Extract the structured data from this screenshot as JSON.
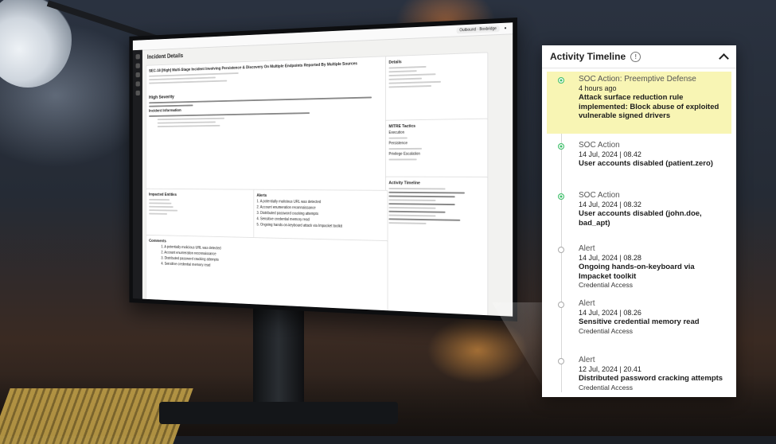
{
  "monitor": {
    "page_title": "Incident Details",
    "incident_title": "SEC-18 [High] Multi-Stage Incident Involving Persistence & Discovery On Multiple Endpoints Reported By Multiple Sources",
    "severity": "High Severity",
    "user": "Outbound · Boxbridge",
    "sections": {
      "details": "Details",
      "mitre": "MITRE Tactics",
      "execution": "Execution",
      "persistence": "Persistence",
      "privesc": "Privilege Escalation",
      "impacted": "Impacted Entities",
      "alerts": "Alerts",
      "comments": "Comments",
      "timeline": "Activity Timeline",
      "info": "Incident Information"
    },
    "alerts_list": [
      "1. A potentially malicious URL was detected",
      "2. Account enumeration reconnaissance",
      "3. Distributed password cracking attempts",
      "4. Sensitive credential memory read",
      "5. Ongoing hands-on-keyboard attack via Impacket toolkit"
    ],
    "comments_list": [
      "1. A potentially malicious URL was detected",
      "2. Account enumeration reconnaissance",
      "3. Distributed password cracking attempts",
      "4. Sensitive credential memory read"
    ]
  },
  "timeline": {
    "title": "Activity Timeline",
    "entries": [
      {
        "type": "SOC Action: Preemptive Defense",
        "time": "4 hours ago",
        "desc": "Attack surface reduction rule implemented: Block abuse of exploited vulnerable signed drivers",
        "tactic": "",
        "marker": "green",
        "highlight": true
      },
      {
        "type": "SOC Action",
        "time": "14 Jul, 2024 | 08.42",
        "desc": "User accounts disabled (patient.zero)",
        "tactic": "",
        "marker": "green",
        "highlight": false
      },
      {
        "type": "SOC Action",
        "time": "14 Jul, 2024 | 08.32",
        "desc": "User accounts disabled (john.doe, bad_apt)",
        "tactic": "",
        "marker": "green",
        "highlight": false
      },
      {
        "type": "Alert",
        "time": "14 Jul, 2024 | 08.28",
        "desc": "Ongoing hands-on-keyboard via Impacket toolkit",
        "tactic": "Credential Access",
        "marker": "grey",
        "highlight": false
      },
      {
        "type": "Alert",
        "time": "14 Jul, 2024 | 08.26",
        "desc": "Sensitive credential memory read",
        "tactic": "Credential Access",
        "marker": "grey",
        "highlight": false
      },
      {
        "type": "Alert",
        "time": "12 Jul, 2024 | 20.41",
        "desc": "Distributed password cracking attempts",
        "tactic": "Credential Access",
        "marker": "grey",
        "highlight": false
      }
    ]
  },
  "colors": {
    "highlight": "#f8f5b4",
    "soc_marker": "#3fbf6a",
    "alert_marker": "#aaaaaa"
  },
  "icons": {
    "info": "info-icon",
    "collapse": "chevron-up-icon"
  }
}
